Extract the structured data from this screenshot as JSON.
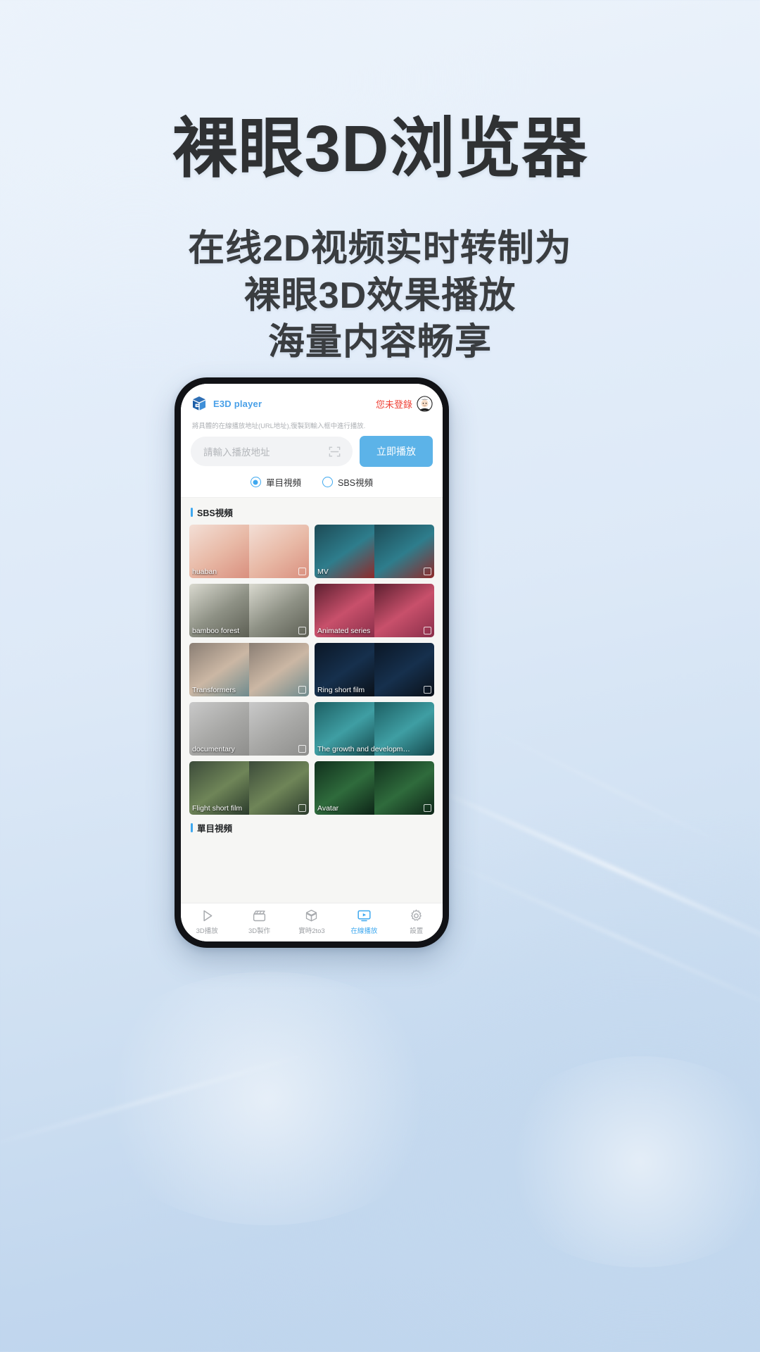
{
  "page": {
    "title": "裸眼3D浏览器",
    "subtitle_lines": [
      "在线2D视频实时转制为",
      "裸眼3D效果播放",
      "海量内容畅享"
    ]
  },
  "colors": {
    "accent": "#3ea8ef",
    "brand_blue": "#49a0e8",
    "button_blue": "#5cb3e8",
    "alert_red": "#ef4136",
    "title_gray": "#2f3133",
    "bg_light": "#eef4fb",
    "bg_deep": "#bcd3ec"
  },
  "app": {
    "brand": {
      "name": "E3D player",
      "logo_icon": "cube-3d-icon"
    },
    "account": {
      "status_text": "您未登錄",
      "avatar_icon": "user-avatar-icon"
    },
    "hint": "將具體的在線播放地址(URL地址),復製到輸入框中進行播放.",
    "address_input": {
      "placeholder": "請輸入播放地址",
      "value": "",
      "scan_icon": "scan-qr-icon"
    },
    "play_button": "立即播放",
    "modes": [
      {
        "label": "單目視頻",
        "selected": true
      },
      {
        "label": "SBS視頻",
        "selected": false
      }
    ],
    "sections": [
      {
        "title": "SBS視頻"
      },
      {
        "title": "單目視頻"
      }
    ],
    "videos": [
      {
        "title": "huaban",
        "c1": "#f3dfd6",
        "c2": "#e8b9a6",
        "c3": "#d98f7e",
        "stereo": true
      },
      {
        "title": "MV",
        "c1": "#1d4a55",
        "c2": "#2e7d8c",
        "c3": "#8f2a2a",
        "stereo": true
      },
      {
        "title": "bamboo forest",
        "c1": "#d9d9cf",
        "c2": "#8e9185",
        "c3": "#5d5f54",
        "stereo": true
      },
      {
        "title": "Animated series",
        "c1": "#5d2030",
        "c2": "#c8506b",
        "c3": "#8a2f4a",
        "stereo": true
      },
      {
        "title": "Transformers",
        "c1": "#8a7e74",
        "c2": "#cbb7a4",
        "c3": "#6f8b8e",
        "stereo": true
      },
      {
        "title": "Ring short film",
        "c1": "#0b1726",
        "c2": "#16304d",
        "c3": "#0a1018",
        "stereo": true
      },
      {
        "title": "documentary",
        "c1": "#c9c9c9",
        "c2": "#a8a8a6",
        "c3": "#8e8e8c",
        "stereo": true
      },
      {
        "title": "The growth and developm…",
        "c1": "#1d5f63",
        "c2": "#3f9ea3",
        "c3": "#15494d",
        "stereo": false
      },
      {
        "title": "Flight short film",
        "c1": "#3c4b3a",
        "c2": "#6f8558",
        "c3": "#2b3b2c",
        "stereo": true
      },
      {
        "title": "Avatar",
        "c1": "#11301d",
        "c2": "#2f6b3c",
        "c3": "#0d2417",
        "stereo": true
      }
    ],
    "tabs": [
      {
        "label": "3D播放",
        "icon": "play-triangle-icon",
        "active": false
      },
      {
        "label": "3D製作",
        "icon": "film-clapper-icon",
        "active": false
      },
      {
        "label": "實時2to3",
        "icon": "cube-convert-icon",
        "active": false
      },
      {
        "label": "在線播放",
        "icon": "monitor-play-icon",
        "active": true
      },
      {
        "label": "設置",
        "icon": "gear-icon",
        "active": false
      }
    ]
  }
}
